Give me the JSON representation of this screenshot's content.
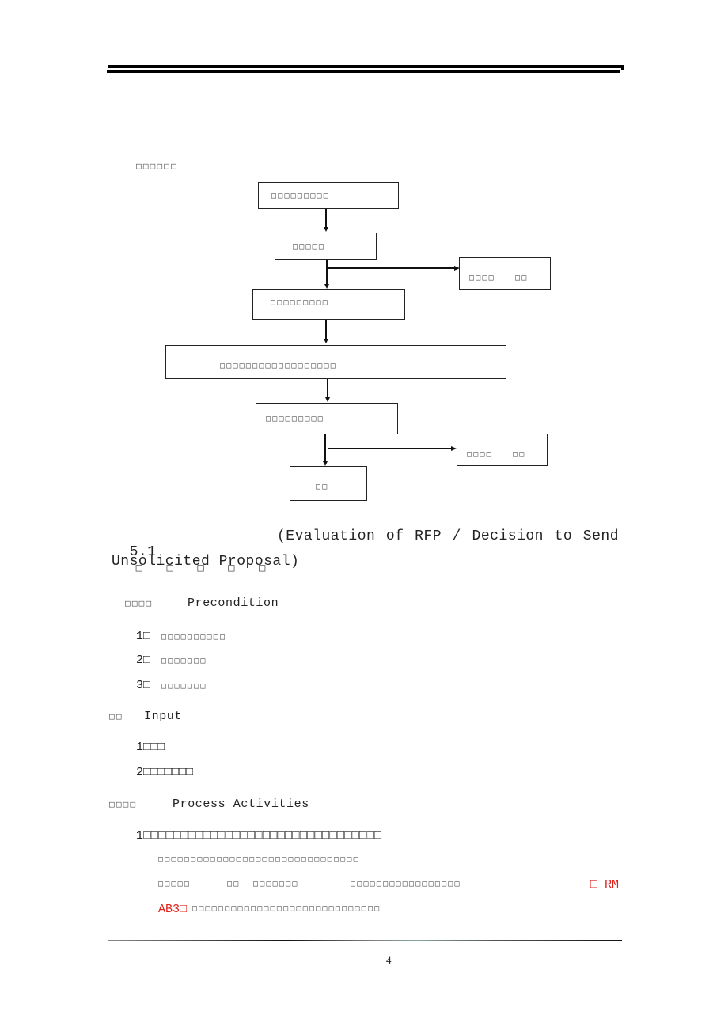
{
  "page": {
    "number": "4",
    "chart_caption": "□□□□□□"
  },
  "flowchart": {
    "nodes": [
      {
        "id": "n1",
        "label": "□□□□□□□□□"
      },
      {
        "id": "n2",
        "label": "□□□□□"
      },
      {
        "id": "n3",
        "label": "□□□□□□□□□"
      },
      {
        "id": "n4",
        "label": "□□□□□□□□□□□□□□□□□□"
      },
      {
        "id": "n5",
        "label": "□□□□□□□□□"
      },
      {
        "id": "n6",
        "label": "□□"
      },
      {
        "id": "side1",
        "label": "□□□□",
        "label2": "□□"
      },
      {
        "id": "side2",
        "label": "□□□□",
        "label2": "□□"
      }
    ]
  },
  "section": {
    "heading_num": "5.1",
    "heading_cjk": "□ □ □ □ □",
    "heading_en_line1": "(Evaluation of RFP / Decision to Send",
    "heading_en_line2": "Unsolicited Proposal)",
    "precondition": {
      "label_cjk": "□□□□",
      "label_en": "Precondition",
      "items": [
        {
          "num": "1□",
          "text": "□□□□□□□□□□"
        },
        {
          "num": "2□",
          "text": "□□□□□□□"
        },
        {
          "num": "3□",
          "text": "□□□□□□□"
        }
      ]
    },
    "input": {
      "label_cjk": "□□",
      "label_en": "Input",
      "items": [
        {
          "text": "1□□□"
        },
        {
          "text": "2□□□□□□□"
        }
      ]
    },
    "process": {
      "label_cjk": "□□□□",
      "label_en": "Process Activities",
      "line1": "1□□□□□□□□□□□□□□□□□□□□□□□□□□□□□□□□",
      "line2": "□□□□□□□□□□□□□□□□□□□□□□□□□□□□□□□",
      "line3_a": "□□□□□",
      "line3_b": "□□",
      "line3_c": "□□□□□□□",
      "line3_d": "□□□□□□□□□□□□□□□□□",
      "line3_red": "□ RM",
      "line4_red": "AB3□",
      "line4": "□□□□□□□□□□□□□□□□□□□□□□□□□□□□□"
    }
  }
}
